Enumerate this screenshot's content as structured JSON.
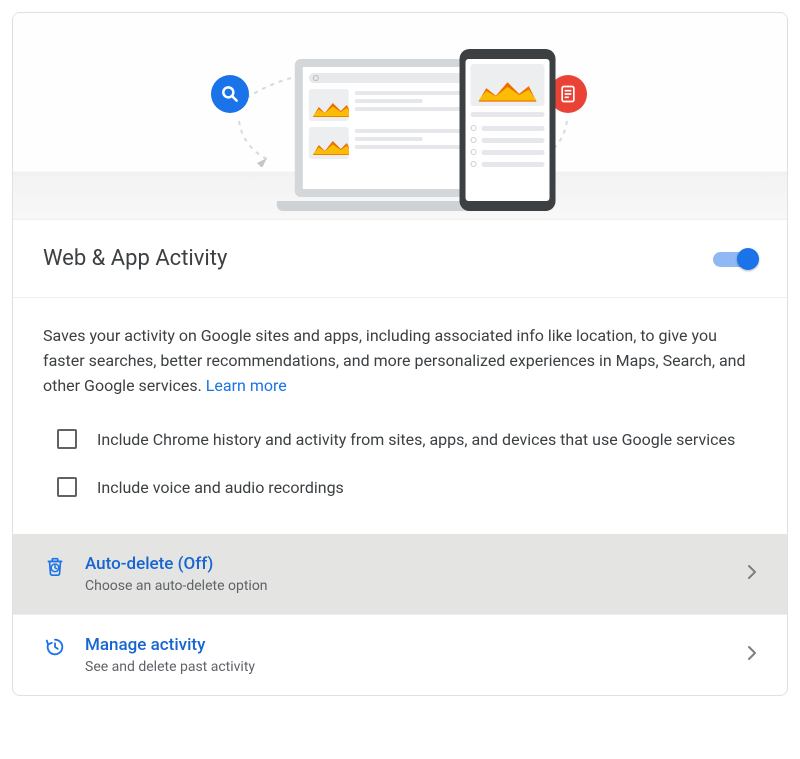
{
  "header": {
    "title": "Web & App Activity",
    "toggle_on": true
  },
  "description": {
    "text": "Saves your activity on Google sites and apps, including associated info like location, to give you faster searches, better recommendations, and more personalized experiences in Maps, Search, and other Google services.",
    "learn_more_label": "Learn more"
  },
  "options": [
    {
      "checked": false,
      "label": "Include Chrome history and activity from sites, apps, and devices that use Google services"
    },
    {
      "checked": false,
      "label": "Include voice and audio recordings"
    }
  ],
  "actions": {
    "auto_delete": {
      "title": "Auto-delete (Off)",
      "subtitle": "Choose an auto-delete option"
    },
    "manage": {
      "title": "Manage activity",
      "subtitle": "See and delete past activity"
    }
  },
  "colors": {
    "primary": "#1a73e8",
    "link": "#1a73e8",
    "danger": "#ea4335"
  }
}
